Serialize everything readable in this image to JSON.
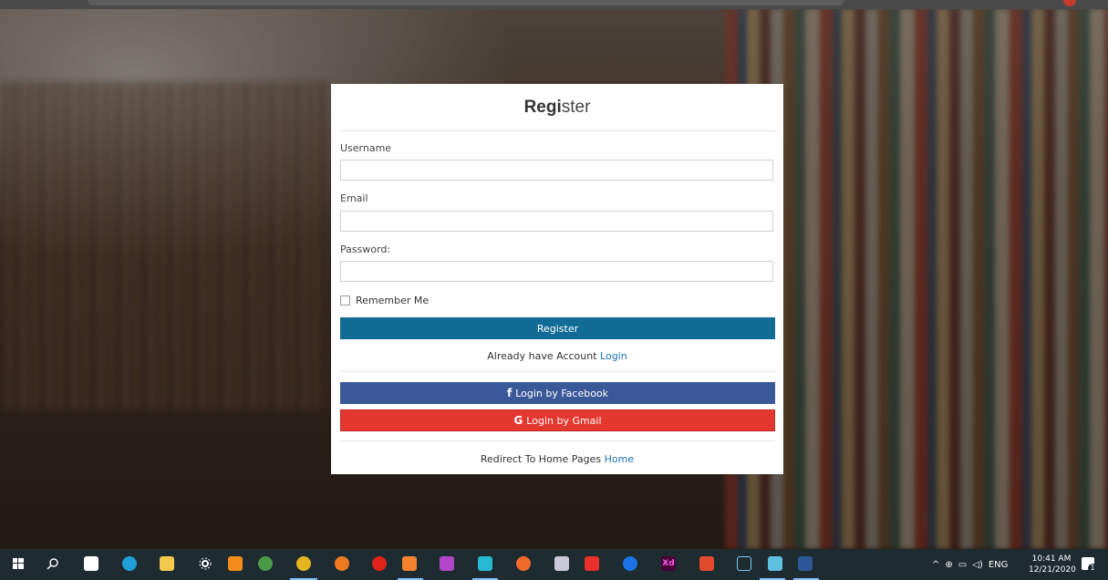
{
  "form": {
    "title_bold": "Regi",
    "title_light": "ster",
    "username_label": "Username",
    "email_label": "Email",
    "password_label": "Password:",
    "remember_label": "Remember Me",
    "register_button": "Register",
    "account_prefix": "Already have Account ",
    "login_link": "Login",
    "facebook_icon": "f",
    "facebook_button": "Login by Facebook",
    "gmail_icon": "G",
    "gmail_button": "Login by Gmail",
    "redirect_prefix": "Redirect To Home Pages ",
    "home_link": "Home",
    "username_value": "",
    "email_value": "",
    "password_value": ""
  },
  "colors": {
    "register": "#126c96",
    "facebook": "#3b5998",
    "gmail": "#e4372f",
    "link": "#1d72b8"
  },
  "taskbar": {
    "apps": [
      {
        "name": "start-icon"
      },
      {
        "name": "search-icon"
      },
      {
        "name": "mail-icon"
      },
      {
        "name": "edge-icon"
      },
      {
        "name": "file-explorer-icon"
      },
      {
        "name": "settings-icon"
      },
      {
        "name": "xampp-icon"
      },
      {
        "name": "heidisql-icon"
      },
      {
        "name": "chrome-icon"
      },
      {
        "name": "firefox-icon"
      },
      {
        "name": "opera-icon"
      },
      {
        "name": "sublime-text-icon"
      },
      {
        "name": "phpstorm-icon"
      },
      {
        "name": "webstorm-icon"
      },
      {
        "name": "postman-icon"
      },
      {
        "name": "paint-icon"
      },
      {
        "name": "anydesk-icon"
      },
      {
        "name": "teamviewer-icon"
      },
      {
        "name": "adobe-xd-icon",
        "label": "Xd"
      },
      {
        "name": "codeigniter-icon"
      },
      {
        "name": "eclipse-icon"
      },
      {
        "name": "virtualbox-icon"
      },
      {
        "name": "word-icon"
      }
    ],
    "tray": {
      "language": "ENG",
      "time": "10:41 AM",
      "date": "12/21/2020",
      "notification_count": "1"
    }
  }
}
